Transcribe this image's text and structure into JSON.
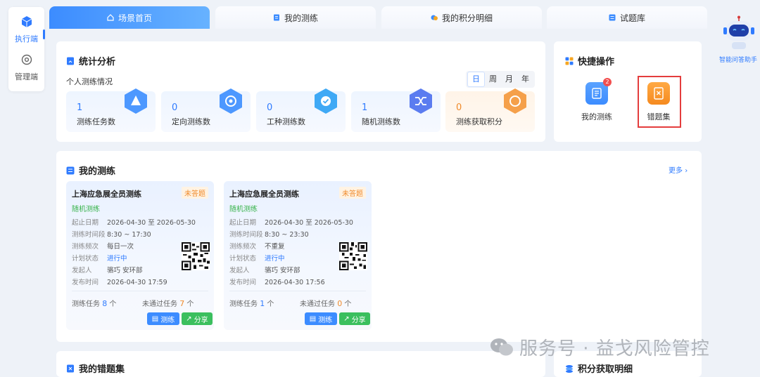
{
  "sidebar": {
    "items": [
      {
        "label": "执行端",
        "icon": "cube-icon",
        "active": true
      },
      {
        "label": "管理端",
        "icon": "gear-icon",
        "active": false
      }
    ]
  },
  "tabs": [
    {
      "label": "场景首页",
      "icon": "home-icon",
      "active": true
    },
    {
      "label": "我的测练",
      "icon": "document-icon",
      "active": false
    },
    {
      "label": "我的积分明细",
      "icon": "coins-icon",
      "active": false
    },
    {
      "label": "试题库",
      "icon": "list-icon",
      "active": false
    }
  ],
  "stats": {
    "title": "统计分析",
    "subtitle": "个人测练情况",
    "periods": [
      "日",
      "周",
      "月",
      "年"
    ],
    "selected_period": "日",
    "cards": [
      {
        "value": "1",
        "label": "测练任务数",
        "color": "#2f7bff"
      },
      {
        "value": "0",
        "label": "定向测练数",
        "color": "#2f7bff"
      },
      {
        "value": "0",
        "label": "工种测练数",
        "color": "#2f7bff"
      },
      {
        "value": "1",
        "label": "随机测练数",
        "color": "#2f7bff"
      },
      {
        "value": "0",
        "label": "测练获取积分",
        "color": "#f08b2c"
      }
    ]
  },
  "quick": {
    "title": "快捷操作",
    "items": [
      {
        "label": "我的测练",
        "badge": "2",
        "icon": "checklist-icon"
      },
      {
        "label": "错题集",
        "icon": "error-book-icon"
      }
    ]
  },
  "my_practice": {
    "title": "我的测练",
    "more": "更多",
    "cards": [
      {
        "title": "上海应急展全员测练",
        "status": "未答题",
        "type": "随机测练",
        "rows": [
          {
            "k": "起止日期",
            "v": "2026-04-30 至 2026-05-30"
          },
          {
            "k": "测练时间段",
            "v": "8:30 ~ 17:30"
          },
          {
            "k": "测练频次",
            "v": "每日一次"
          },
          {
            "k": "计划状态",
            "v": "进行中"
          },
          {
            "k": "发起人",
            "v": "骆巧  安环部"
          },
          {
            "k": "发布时间",
            "v": "2026-04-30 17:59"
          }
        ],
        "task_label": "测练任务",
        "task_count": "8",
        "unit": "个",
        "fail_label": "未通过任务",
        "fail_count": "7",
        "btn_practice": "测练",
        "btn_share": "分享"
      },
      {
        "title": "上海应急展全员测练",
        "status": "未答题",
        "type": "随机测练",
        "rows": [
          {
            "k": "起止日期",
            "v": "2026-04-30 至 2026-05-30"
          },
          {
            "k": "测练时间段",
            "v": "8:30 ~ 23:30"
          },
          {
            "k": "测练频次",
            "v": "不重复"
          },
          {
            "k": "计划状态",
            "v": "进行中"
          },
          {
            "k": "发起人",
            "v": "骆巧  安环部"
          },
          {
            "k": "发布时间",
            "v": "2026-04-30 17:56"
          }
        ],
        "task_label": "测练任务",
        "task_count": "1",
        "unit": "个",
        "fail_label": "未通过任务",
        "fail_count": "0",
        "btn_practice": "测练",
        "btn_share": "分享"
      }
    ]
  },
  "wrong_set": {
    "title": "我的错题集"
  },
  "points_detail": {
    "title": "积分获取明细"
  },
  "assistant": {
    "label": "智能问答助手"
  },
  "watermark": {
    "text": "服务号 · 益戈风险管控"
  },
  "colors": {
    "primary": "#2f7bff",
    "orange": "#f08b2c",
    "green": "#3bbf5e",
    "highlight": "#e43d3d"
  }
}
